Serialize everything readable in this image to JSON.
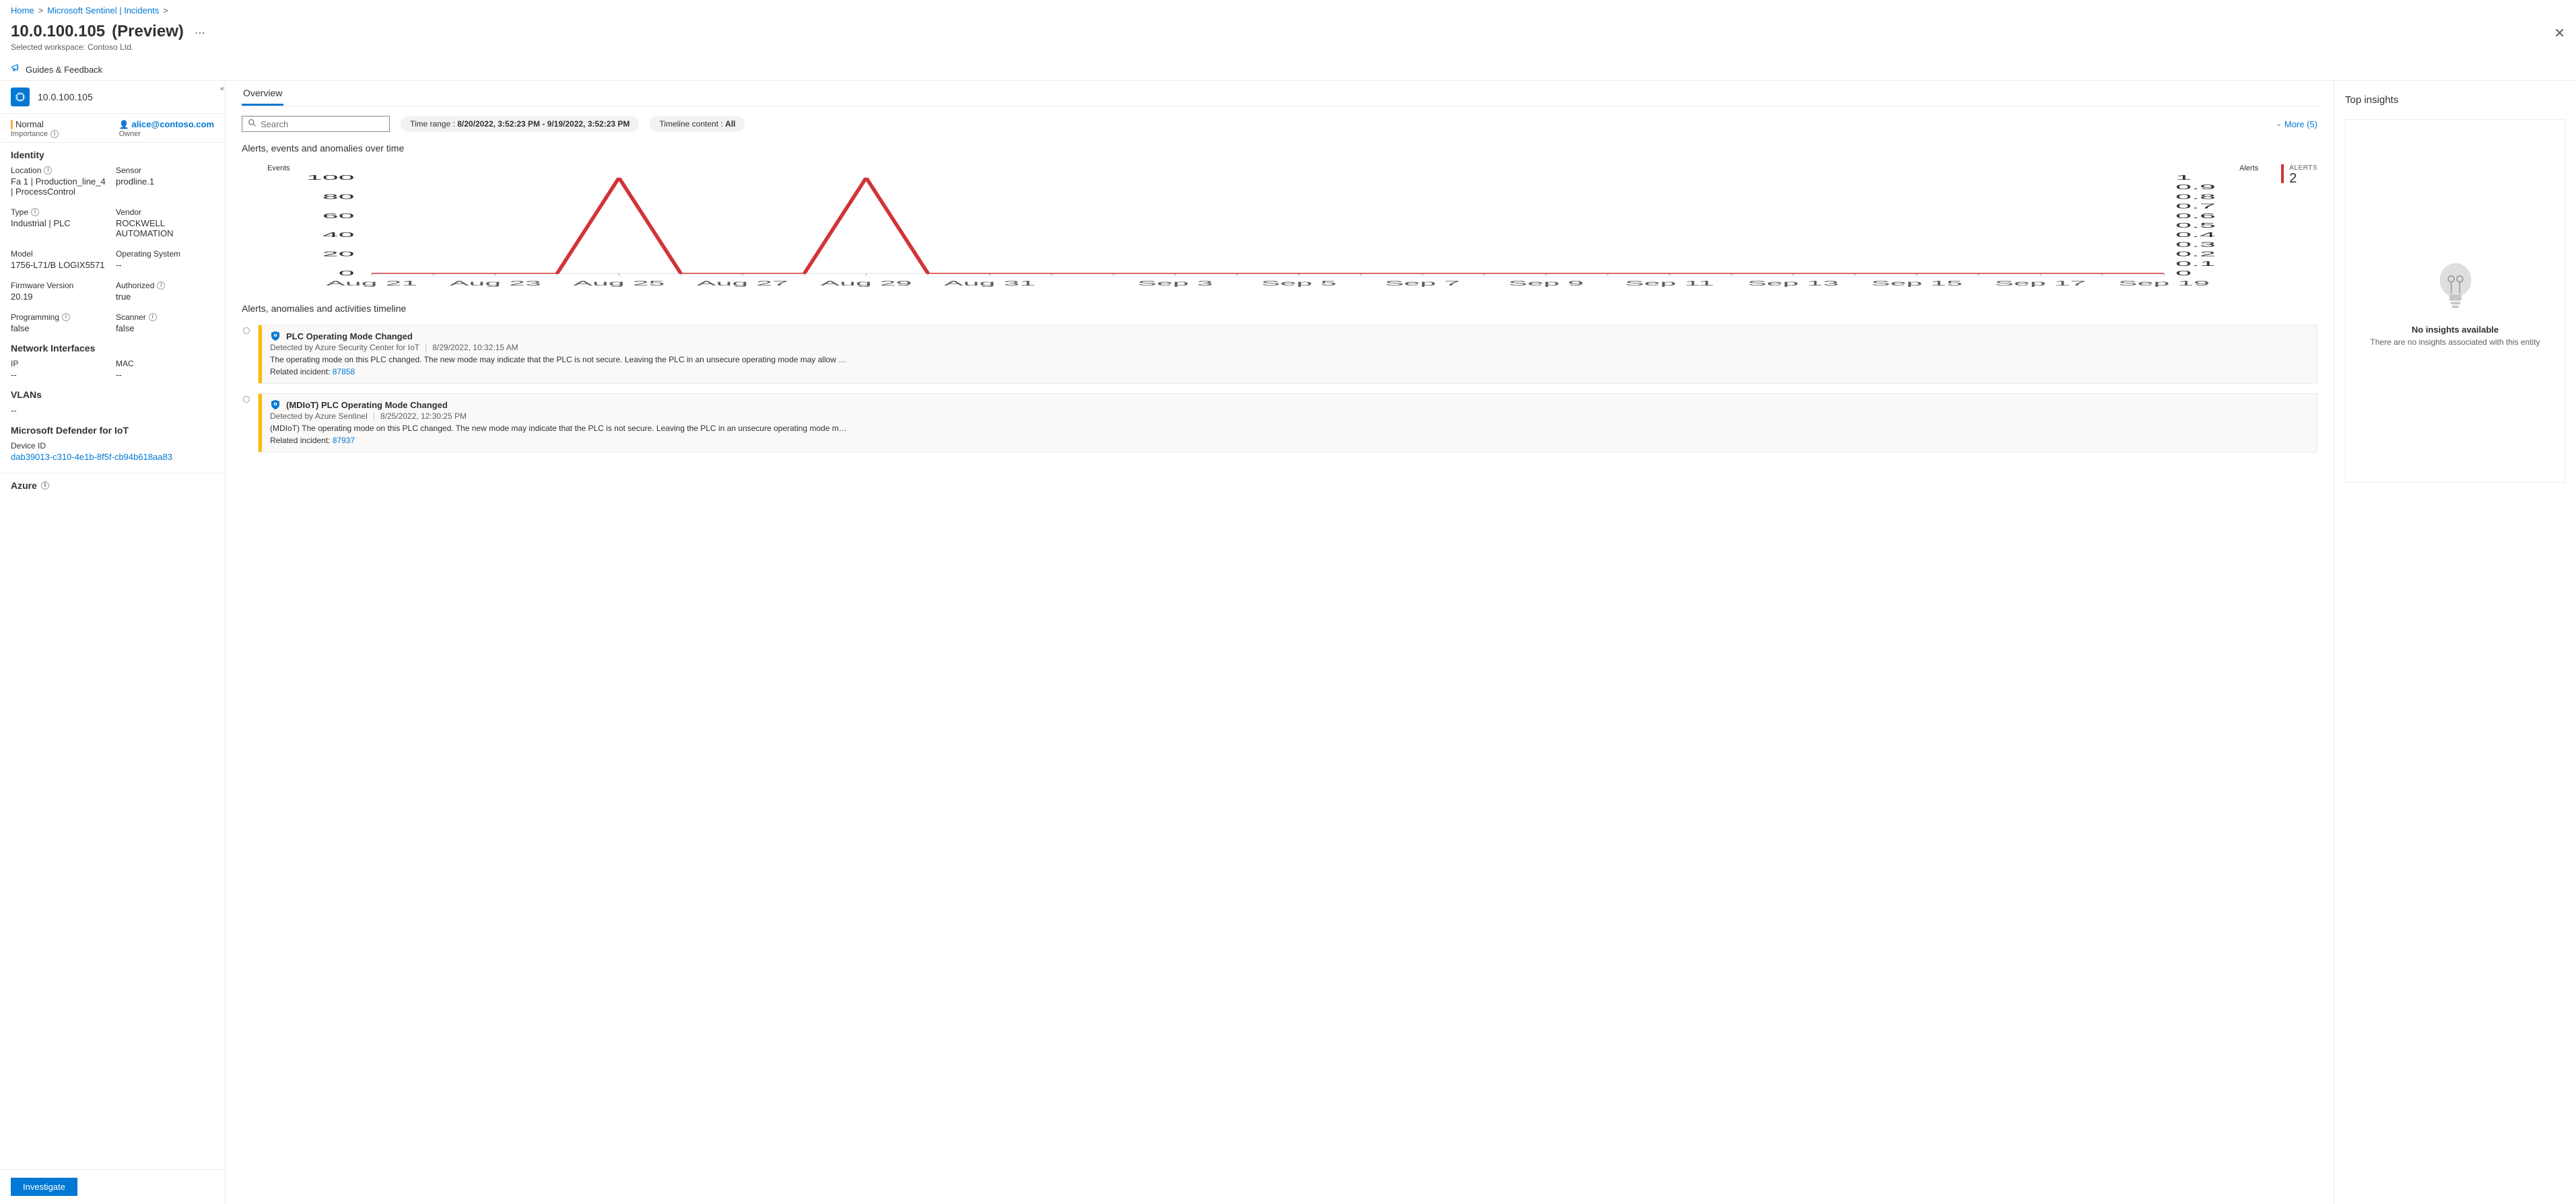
{
  "breadcrumb": {
    "items": [
      "Home",
      "Microsoft Sentinel | Incidents"
    ]
  },
  "header": {
    "title": "10.0.100.105",
    "preview": "(Preview)",
    "workspace_label": "Selected workspace:",
    "workspace_value": "Contoso Ltd."
  },
  "toolbar": {
    "guides": "Guides & Feedback"
  },
  "entity": {
    "name": "10.0.100.105"
  },
  "status": {
    "importance_value": "Normal",
    "importance_label": "Importance",
    "owner_value": "alice@contoso.com",
    "owner_label": "Owner"
  },
  "sidebar": {
    "identity_title": "Identity",
    "identity": [
      {
        "label": "Location",
        "value": "Fa 1 | Production_line_4 | ProcessControl",
        "info": true
      },
      {
        "label": "Sensor",
        "value": "prodline.1",
        "info": false
      },
      {
        "label": "Type",
        "value": "Industrial | PLC",
        "info": true
      },
      {
        "label": "Vendor",
        "value": "ROCKWELL AUTOMATION",
        "info": false
      },
      {
        "label": "Model",
        "value": "1756-L71/B LOGIX5571",
        "info": false
      },
      {
        "label": "Operating System",
        "value": "--",
        "info": false
      },
      {
        "label": "Firmware Version",
        "value": "20.19",
        "info": false
      },
      {
        "label": "Authorized",
        "value": "true",
        "info": true
      },
      {
        "label": "Programming",
        "value": "false",
        "info": true
      },
      {
        "label": "Scanner",
        "value": "false",
        "info": true
      }
    ],
    "network_title": "Network Interfaces",
    "network": [
      {
        "label": "IP",
        "value": "--"
      },
      {
        "label": "MAC",
        "value": "--"
      }
    ],
    "vlans_title": "VLANs",
    "vlans_value": "--",
    "defender_title": "Microsoft Defender for IoT",
    "device_id_label": "Device ID",
    "device_id_value": "dab39013-c310-4e1b-8f5f-cb94b618aa83",
    "azure_title": "Azure"
  },
  "investigate_label": "Investigate",
  "center": {
    "tab_overview": "Overview",
    "search_placeholder": "Search",
    "time_pill_label": "Time range : ",
    "time_pill_value": "8/20/2022, 3:52:23 PM - 9/19/2022, 3:52:23 PM",
    "content_pill_label": "Timeline content : ",
    "content_pill_value": "All",
    "more_label": "More (5)",
    "chart_title": "Alerts, events and anomalies over time",
    "events_label": "Events",
    "alerts_label": "Alerts",
    "alerts_summary_label": "ALERTS",
    "alerts_summary_count": "2",
    "timeline_title": "Alerts, anomalies and activities timeline",
    "timeline": [
      {
        "title": "PLC Operating Mode Changed",
        "source": "Detected by Azure Security Center for IoT",
        "time": "8/29/2022, 10:32:15 AM",
        "desc": "The operating mode on this PLC changed. The new mode may indicate that the PLC is not secure. Leaving the PLC in an unsecure operating mode may allow …",
        "related_label": "Related incident: ",
        "related_id": "87858"
      },
      {
        "title": "(MDIoT) PLC Operating Mode Changed",
        "source": "Detected by Azure Sentinel",
        "time": "8/25/2022, 12:30:25 PM",
        "desc": "(MDIoT) The operating mode on this PLC changed. The new mode may indicate that the PLC is not secure. Leaving the PLC in an unsecure operating mode m…",
        "related_label": "Related incident: ",
        "related_id": "87937"
      }
    ]
  },
  "insights": {
    "title": "Top insights",
    "empty_title": "No insights available",
    "empty_sub": "There are no insights associated with this entity"
  },
  "chart_data": {
    "type": "line",
    "title": "Alerts, events and anomalies over time",
    "x_categories": [
      "Aug 21",
      "Aug 23",
      "Aug 25",
      "Aug 27",
      "Aug 29",
      "Aug 31",
      "Sep 3",
      "Sep 5",
      "Sep 7",
      "Sep 9",
      "Sep 11",
      "Sep 13",
      "Sep 15",
      "Sep 17",
      "Sep 19"
    ],
    "y_left": {
      "label": "Events",
      "ticks": [
        0,
        20,
        40,
        60,
        80,
        100
      ],
      "range": [
        0,
        100
      ]
    },
    "y_right": {
      "label": "Alerts",
      "ticks": [
        0,
        0.1,
        0.2,
        0.3,
        0.4,
        0.5,
        0.6,
        0.7,
        0.8,
        0.9,
        1
      ],
      "range": [
        0,
        1
      ]
    },
    "series": [
      {
        "name": "Alerts",
        "axis": "right",
        "color": "#d13438",
        "x": [
          "Aug 21",
          "Aug 22",
          "Aug 23",
          "Aug 24",
          "Aug 25",
          "Aug 26",
          "Aug 27",
          "Aug 28",
          "Aug 29",
          "Aug 30",
          "Aug 31",
          "Sep 1",
          "Sep 2",
          "Sep 3",
          "Sep 4",
          "Sep 5",
          "Sep 6",
          "Sep 7",
          "Sep 8",
          "Sep 9",
          "Sep 10",
          "Sep 11",
          "Sep 12",
          "Sep 13",
          "Sep 14",
          "Sep 15",
          "Sep 16",
          "Sep 17",
          "Sep 18",
          "Sep 19"
        ],
        "values": [
          0,
          0,
          0,
          0,
          1,
          0,
          0,
          0,
          1,
          0,
          0,
          0,
          0,
          0,
          0,
          0,
          0,
          0,
          0,
          0,
          0,
          0,
          0,
          0,
          0,
          0,
          0,
          0,
          0,
          0
        ]
      }
    ]
  }
}
